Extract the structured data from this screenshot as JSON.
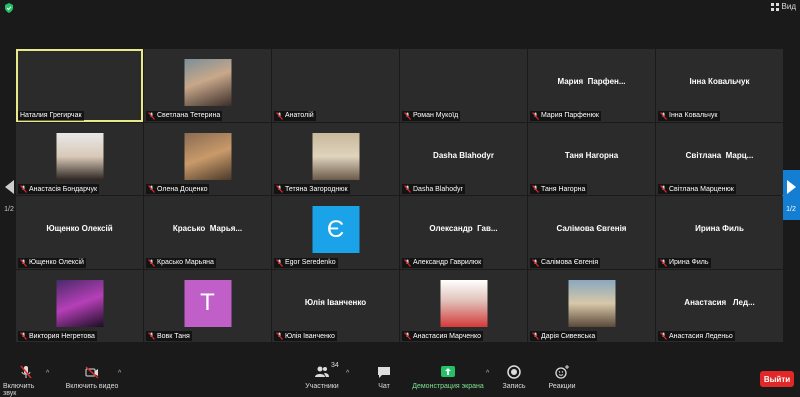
{
  "topbar": {
    "view_label": "Вид"
  },
  "nav": {
    "left_page": "1/2",
    "right_page": "1/2"
  },
  "tiles": [
    {
      "label": "Наталия Грегирчак",
      "big": "",
      "kind": "blank"
    },
    {
      "label": "Светлана Тетерина",
      "big": "",
      "kind": "photo"
    },
    {
      "label": "Анатолій",
      "big": "",
      "kind": "blank"
    },
    {
      "label": "Роман Мукоїд",
      "big": "",
      "kind": "blank"
    },
    {
      "label": "Мария Парфенюк",
      "big": "Мария  Парфен...",
      "kind": "name"
    },
    {
      "label": "Інна Ковальчук",
      "big": "Інна Ковальчук",
      "kind": "name"
    },
    {
      "label": "Анастасія Бондарчук",
      "big": "",
      "kind": "photo"
    },
    {
      "label": "Олена Доценко",
      "big": "",
      "kind": "photo"
    },
    {
      "label": "Тетяна Загороднюк",
      "big": "",
      "kind": "photo"
    },
    {
      "label": "Dasha Blahodyr",
      "big": "Dasha Blahodyr",
      "kind": "name"
    },
    {
      "label": "Таня Нагорна",
      "big": "Таня Нагорна",
      "kind": "name"
    },
    {
      "label": "Світлана Марценюк",
      "big": "Світлана  Марц...",
      "kind": "name"
    },
    {
      "label": "Ющенко Олексій",
      "big": "Ющенко Олексій",
      "kind": "name"
    },
    {
      "label": "Красько Марьяна",
      "big": "Красько  Марья...",
      "kind": "name"
    },
    {
      "label": "Egor Seredenko",
      "big": "",
      "kind": "avatar",
      "letter": "Є",
      "color": "#1aa3e8"
    },
    {
      "label": "Александр Гаврилюк",
      "big": "Олександр  Гав...",
      "kind": "name"
    },
    {
      "label": "Салімова Євгенія",
      "big": "Салімова Євгенія",
      "kind": "name"
    },
    {
      "label": "Ирина Филь",
      "big": "Ирина Филь",
      "kind": "name"
    },
    {
      "label": "Виктория Негретова",
      "big": "",
      "kind": "photo"
    },
    {
      "label": "Вовк Таня",
      "big": "",
      "kind": "avatar",
      "letter": "Т",
      "color": "#c15fc8"
    },
    {
      "label": "Юлія Іванченко",
      "big": "Юлія Іванченко",
      "kind": "name"
    },
    {
      "label": "Анастасия Марченко",
      "big": "",
      "kind": "photo"
    },
    {
      "label": "Дарія Сивевська",
      "big": "",
      "kind": "photo"
    },
    {
      "label": "Анастасия Леденьо",
      "big": "Анастасия   Лед...",
      "kind": "name"
    }
  ],
  "toolbar": {
    "unmute": "Включить звук",
    "start_video": "Включить видео",
    "participants": "Участники",
    "participants_count": "34",
    "chat": "Чат",
    "share_screen": "Демонстрация экрана",
    "record": "Запись",
    "reactions": "Реакции",
    "leave": "Выйти"
  },
  "colors": {
    "active_border": "#e9e98a",
    "share_green": "#23c266",
    "leave_red": "#e02828",
    "nav_blue": "#147fd2"
  }
}
